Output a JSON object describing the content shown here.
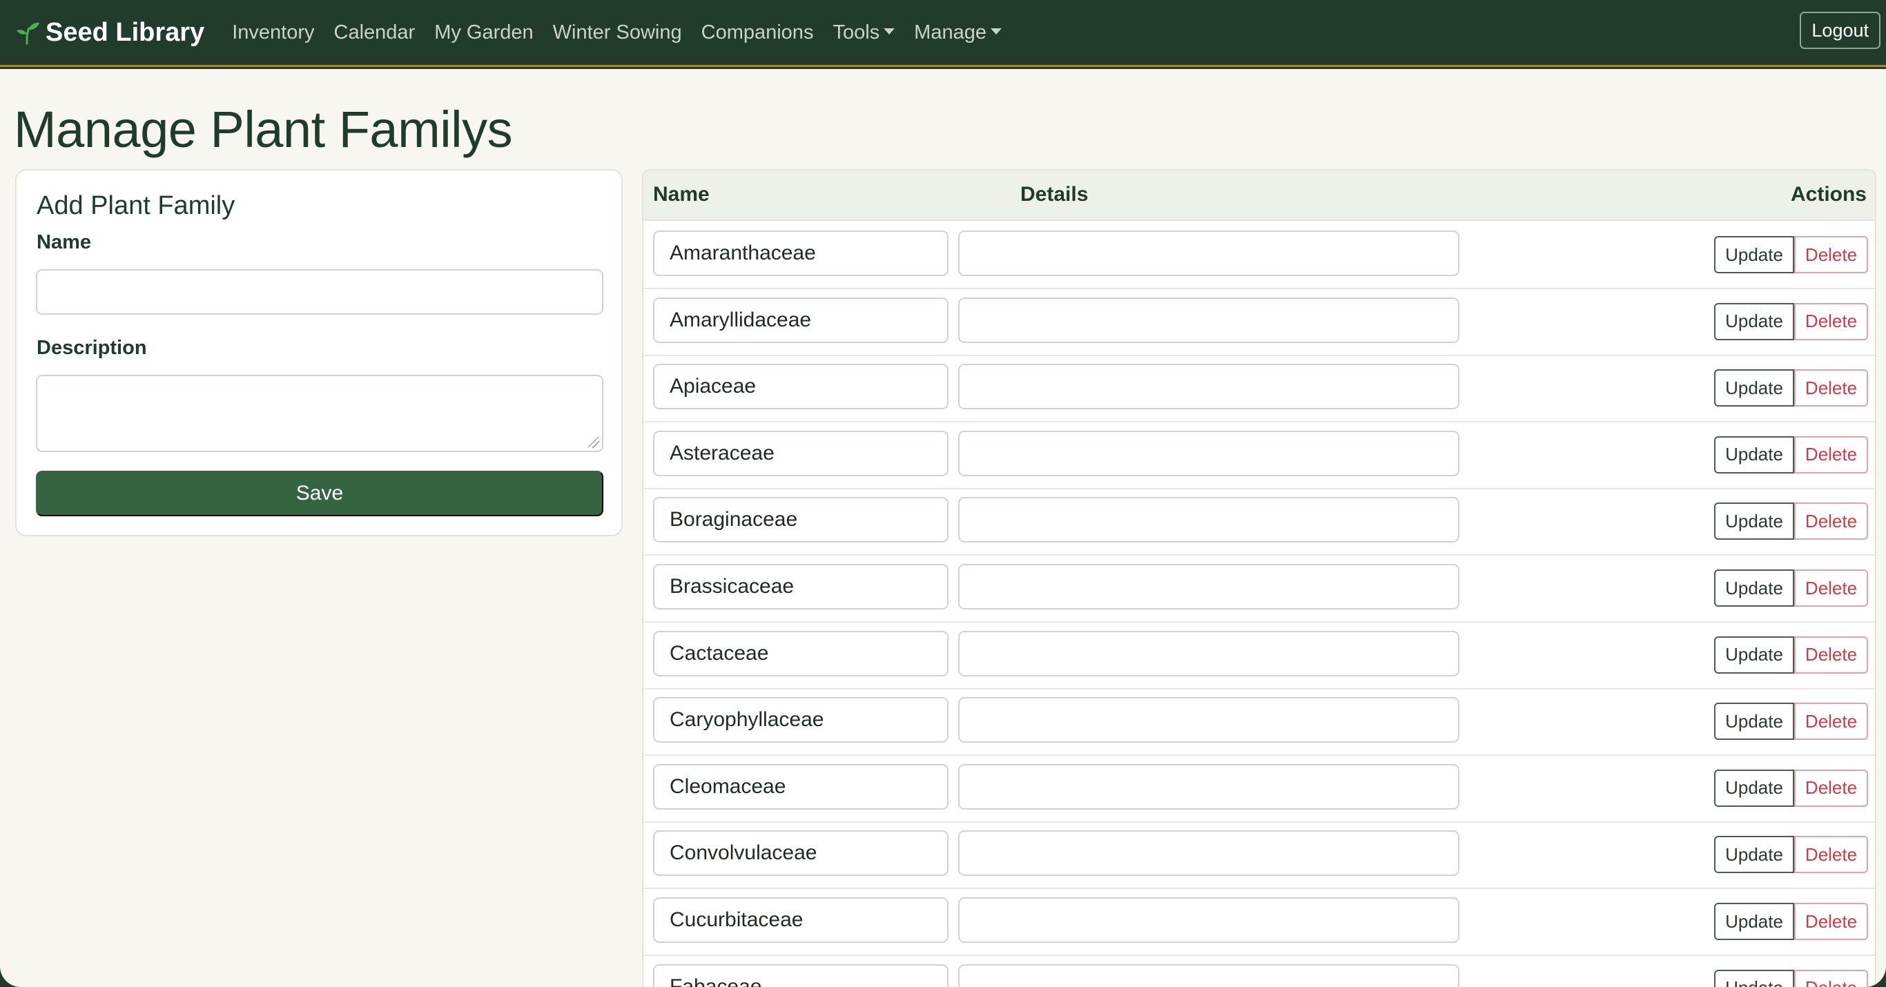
{
  "nav": {
    "brand": "Seed Library",
    "brand_icon": "seedling-icon",
    "links": [
      "Inventory",
      "Calendar",
      "My Garden",
      "Winter Sowing",
      "Companions"
    ],
    "tools_label": "Tools",
    "manage_label": "Manage",
    "logout_label": "Logout"
  },
  "page": {
    "title": "Manage Plant Familys"
  },
  "add_form": {
    "title": "Add Plant Family",
    "name_label": "Name",
    "name_value": "",
    "description_label": "Description",
    "description_value": "",
    "save_label": "Save"
  },
  "table": {
    "headers": {
      "name": "Name",
      "details": "Details",
      "actions": "Actions"
    },
    "update_label": "Update",
    "delete_label": "Delete",
    "rows": [
      {
        "name": "Amaranthaceae",
        "details": ""
      },
      {
        "name": "Amaryllidaceae",
        "details": ""
      },
      {
        "name": "Apiaceae",
        "details": ""
      },
      {
        "name": "Asteraceae",
        "details": ""
      },
      {
        "name": "Boraginaceae",
        "details": ""
      },
      {
        "name": "Brassicaceae",
        "details": ""
      },
      {
        "name": "Cactaceae",
        "details": ""
      },
      {
        "name": "Caryophyllaceae",
        "details": ""
      },
      {
        "name": "Cleomaceae",
        "details": ""
      },
      {
        "name": "Convolvulaceae",
        "details": ""
      },
      {
        "name": "Cucurbitaceae",
        "details": ""
      },
      {
        "name": "Fabaceae",
        "details": ""
      }
    ]
  },
  "colors": {
    "navbar": "#213c2b",
    "accent_border": "#a98a3a",
    "background": "#f8f6f0",
    "primary_button": "#356441",
    "delete_text": "#d23a45"
  }
}
